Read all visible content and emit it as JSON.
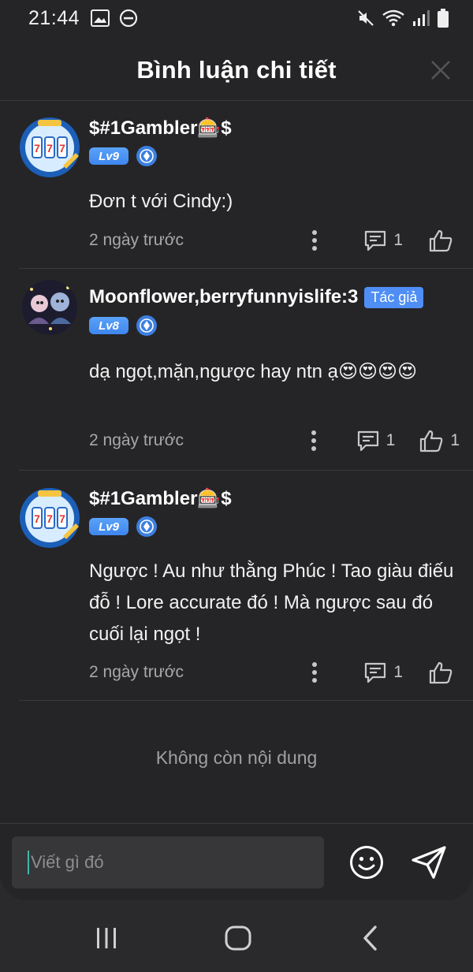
{
  "status_bar": {
    "time": "21:44",
    "left_icons": [
      "image-icon",
      "do-not-disturb-icon"
    ],
    "right_icons": [
      "mute-icon",
      "wifi-icon",
      "signal-icon",
      "battery-icon"
    ]
  },
  "header": {
    "title": "Bình luận chi tiết",
    "close_icon": "close-icon"
  },
  "comments": [
    {
      "username": "$#1Gambler🎰$",
      "author_tag": "",
      "level": "Lv9",
      "text": "Đơn t với Cindy:)",
      "time": "2 ngày trước",
      "reply_count": "1",
      "like_count": ""
    },
    {
      "username": "Moonflower,berryfunnyislife:3",
      "author_tag": "Tác giả",
      "level": "Lv8",
      "text": "dạ ngọt,mặn,ngược hay ntn ạ😍😍😍😍",
      "time": "2 ngày trước",
      "reply_count": "1",
      "like_count": "1"
    },
    {
      "username": "$#1Gambler🎰$",
      "author_tag": "",
      "level": "Lv9",
      "text": "Ngược ! Au như thằng Phúc ! Tao giàu điếu đỗ ! Lore accurate đó ! Mà ngược sau đó cuối lại ngọt !",
      "time": "2 ngày trước",
      "reply_count": "1",
      "like_count": ""
    }
  ],
  "footer_message": "Không còn nội dung",
  "composer": {
    "placeholder": "Viết gì đó",
    "emoji_icon": "emoji-icon",
    "send_icon": "send-icon"
  },
  "nav": {
    "icons": [
      "recent-apps-icon",
      "home-icon",
      "back-icon"
    ]
  },
  "colors": {
    "background": "#252527",
    "accent": "#4f8ef5",
    "secondary_text": "#a8a8aa"
  }
}
